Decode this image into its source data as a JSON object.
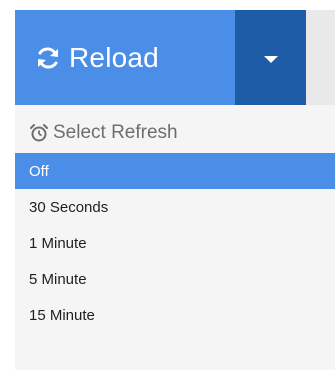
{
  "toolbar": {
    "reload_label": "Reload",
    "reload_icon": "refresh-icon",
    "toggle_icon": "caret-down-icon"
  },
  "dropdown": {
    "header": {
      "label": "Select Refresh",
      "icon": "alarm-clock-icon"
    },
    "items": [
      {
        "label": "Off",
        "selected": true
      },
      {
        "label": "30 Seconds",
        "selected": false
      },
      {
        "label": "1 Minute",
        "selected": false
      },
      {
        "label": "5 Minute",
        "selected": false
      },
      {
        "label": "15 Minute",
        "selected": false
      }
    ]
  },
  "colors": {
    "primary": "#4b8ee8",
    "primary_dark": "#1f5ca8",
    "menu_bg": "#f5f5f5",
    "header_text": "#6e6e6e"
  }
}
